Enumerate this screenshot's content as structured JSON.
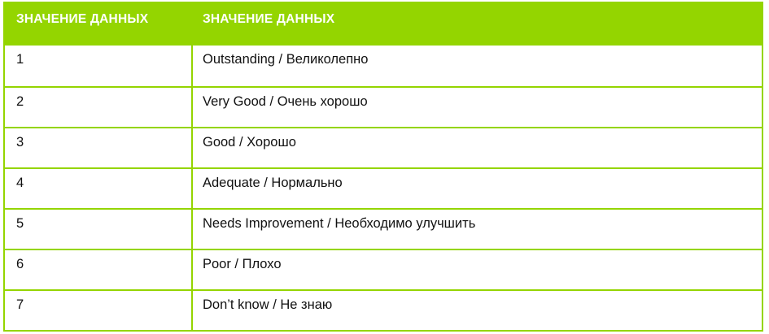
{
  "colors": {
    "accent": "#94d500",
    "header_text": "#ffffff",
    "body_text": "#111111"
  },
  "table": {
    "headers": [
      "ЗНАЧЕНИЕ ДАННЫХ",
      "ЗНАЧЕНИЕ ДАННЫХ"
    ],
    "rows": [
      [
        "1",
        "Outstanding / Великолепно"
      ],
      [
        "2",
        "Very Good / Очень хорошо"
      ],
      [
        "3",
        "Good / Хорошо"
      ],
      [
        "4",
        "Adequate / Нормально"
      ],
      [
        "5",
        "Needs Improvement / Необходимо улучшить"
      ],
      [
        "6",
        "Poor / Плохо"
      ],
      [
        "7",
        "Don’t know / Не знаю"
      ]
    ]
  }
}
